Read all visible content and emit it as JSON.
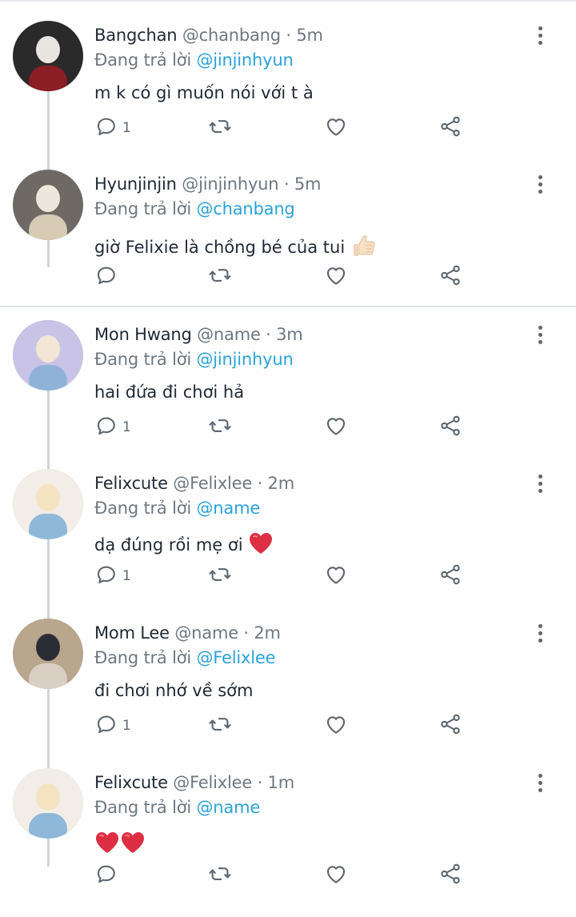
{
  "reply_prefix": "Đang trả lời",
  "accent_color": "#2aa3d8",
  "tweets": [
    {
      "name": "Bangchan",
      "handle": "@chanbang",
      "time": "5m",
      "mention": "@jinjinhyun",
      "text": "m k có gì muốn nói với t à",
      "emoji": [],
      "reply_count": "1"
    },
    {
      "name": "Hyunjinjin",
      "handle": "@jinjinhyun",
      "time": "5m",
      "mention": "@chanbang",
      "text": "giờ Felixie là chồng bé của tui",
      "emoji": [
        "thumbs-up"
      ],
      "reply_count": ""
    },
    {
      "name": "Mon Hwang",
      "handle": "@name",
      "time": "3m",
      "mention": "@jinjinhyun",
      "text": "hai đứa đi chơi hả",
      "emoji": [],
      "reply_count": "1"
    },
    {
      "name": "Felixcute",
      "handle": "@Felixlee",
      "time": "2m",
      "mention": "@name",
      "text": "dạ đúng rồi mẹ ơi",
      "emoji": [
        "red-heart"
      ],
      "reply_count": "1"
    },
    {
      "name": "Mom Lee",
      "handle": "@name",
      "time": "2m",
      "mention": "@Felixlee",
      "text": "đi chơi nhớ về sớm",
      "emoji": [],
      "reply_count": "1"
    },
    {
      "name": "Felixcute",
      "handle": "@Felixlee",
      "time": "1m",
      "mention": "@name",
      "text": "",
      "emoji": [
        "red-heart",
        "red-heart"
      ],
      "reply_count": ""
    }
  ],
  "icons": {
    "reply": "reply-icon",
    "retweet": "retweet-icon",
    "like": "heart-icon",
    "share": "share-icon",
    "more": "more-vertical-icon"
  }
}
